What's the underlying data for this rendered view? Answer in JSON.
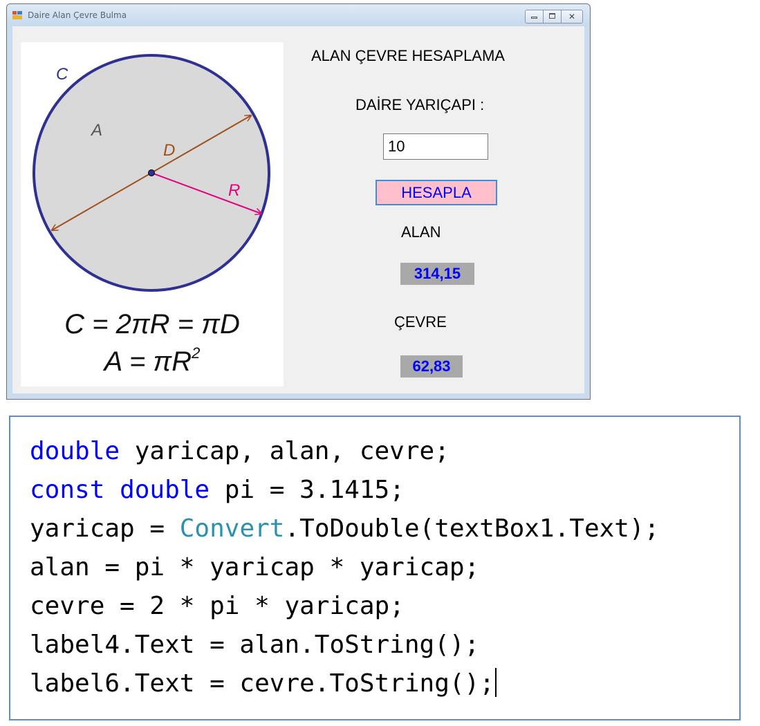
{
  "window": {
    "title": "Daire Alan Çevre Bulma",
    "controls": {
      "minimize": "minimize",
      "maximize": "maximize",
      "close": "close"
    }
  },
  "picture": {
    "labels": {
      "c": "C",
      "a": "A",
      "d": "D",
      "r": "R"
    },
    "formula1": "C = 2πR = πD",
    "formula2_main": "A = πR",
    "formula2_sup": "2",
    "colors": {
      "circle_fill": "#d9d9d9",
      "circle_stroke": "#2e3192",
      "diameter": "#a0501e",
      "radius": "#e6007e"
    }
  },
  "form": {
    "heading": "ALAN ÇEVRE HESAPLAMA",
    "radius_label": "DAİRE YARIÇAPI :",
    "radius_value": "10",
    "calculate_button": "HESAPLA",
    "area_label": "ALAN",
    "area_value": "314,15",
    "perimeter_label": "ÇEVRE",
    "perimeter_value": "62,83"
  },
  "code": {
    "line1": {
      "kw": "double",
      "rest": " yaricap, alan, cevre;"
    },
    "line2": {
      "kw1": "const",
      "kw2": "double",
      "rest": " pi = 3.1415;"
    },
    "line3": {
      "pre": "yaricap = ",
      "type": "Convert",
      "post": ".ToDouble(textBox1.Text);"
    },
    "line4": "alan = pi * yaricap * yaricap;",
    "line5": "cevre = 2 * pi * yaricap;",
    "line6": "label4.Text = alan.ToString();",
    "line7": "label6.Text = cevre.ToString();"
  }
}
